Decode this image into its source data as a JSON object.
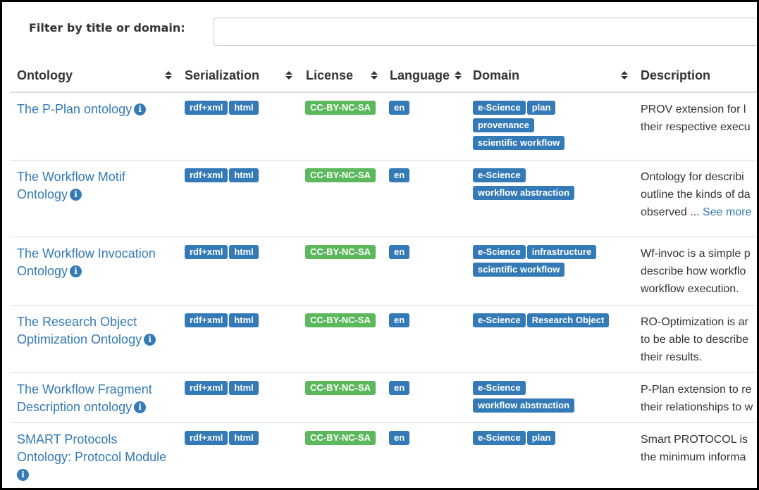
{
  "filter": {
    "label": "Filter by title or domain:",
    "value": ""
  },
  "columns": [
    {
      "label": "Ontology"
    },
    {
      "label": "Serialization"
    },
    {
      "label": "License"
    },
    {
      "label": "Language"
    },
    {
      "label": "Domain"
    },
    {
      "label": "Description"
    }
  ],
  "rows": [
    {
      "title": "The P-Plan ontology",
      "serialization": [
        "rdf+xml",
        "html"
      ],
      "license": "CC-BY-NC-SA",
      "language": "en",
      "domains": [
        "e-Science",
        "plan",
        "provenance",
        "scientific workflow"
      ],
      "desc_lines": [
        "PROV extension for l",
        "their respective execu"
      ],
      "see_more": ""
    },
    {
      "title": "The Workflow Motif Ontology",
      "serialization": [
        "rdf+xml",
        "html"
      ],
      "license": "CC-BY-NC-SA",
      "language": "en",
      "domains": [
        "e-Science",
        "workflow abstraction"
      ],
      "desc_lines": [
        "Ontology for describi",
        "outline the kinds of da",
        "observed ... "
      ],
      "see_more": "See more"
    },
    {
      "title": "The Workflow Invocation Ontology",
      "serialization": [
        "rdf+xml",
        "html"
      ],
      "license": "CC-BY-NC-SA",
      "language": "en",
      "domains": [
        "e-Science",
        "infrastructure",
        "scientific workflow"
      ],
      "desc_lines": [
        "Wf-invoc is a simple p",
        "describe how workflo",
        "workflow execution."
      ],
      "see_more": ""
    },
    {
      "title": "The Research Object Optimization Ontology",
      "serialization": [
        "rdf+xml",
        "html"
      ],
      "license": "CC-BY-NC-SA",
      "language": "en",
      "domains": [
        "e-Science",
        "Research Object"
      ],
      "desc_lines": [
        "RO-Optimization is ar",
        "to be able to describe",
        "their results."
      ],
      "see_more": ""
    },
    {
      "title": "The Workflow Fragment Description ontology",
      "serialization": [
        "rdf+xml",
        "html"
      ],
      "license": "CC-BY-NC-SA",
      "language": "en",
      "domains": [
        "e-Science",
        "workflow abstraction"
      ],
      "desc_lines": [
        "P-Plan extension to re",
        "their relationships to w"
      ],
      "see_more": ""
    },
    {
      "title": "SMART Protocols Ontology: Protocol Module",
      "serialization": [
        "rdf+xml",
        "html"
      ],
      "license": "CC-BY-NC-SA",
      "language": "en",
      "domains": [
        "e-Science",
        "plan"
      ],
      "desc_lines": [
        "Smart PROTOCOL is",
        "the minimum informa"
      ],
      "see_more": ""
    }
  ]
}
